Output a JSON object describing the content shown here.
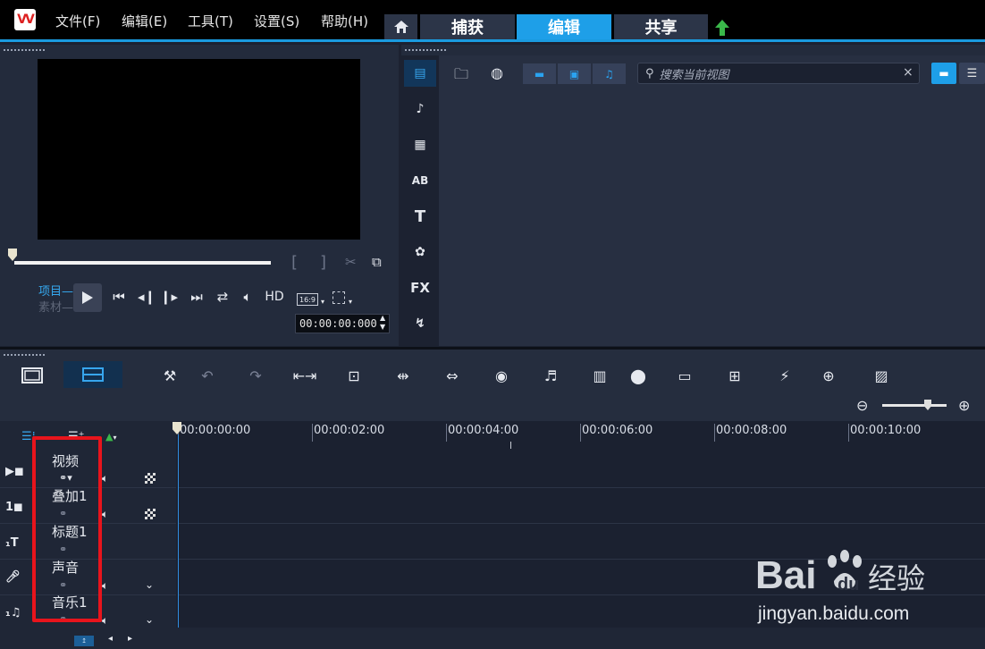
{
  "menu": {
    "items": [
      "文件(F)",
      "编辑(E)",
      "工具(T)",
      "设置(S)",
      "帮助(H)"
    ]
  },
  "tabs": [
    "捕获",
    "编辑",
    "共享"
  ],
  "active_tab": "编辑",
  "preview": {
    "mode_project": "项目",
    "mode_clip": "素材",
    "hd_label": "HD",
    "aspect_ratio": "16:9",
    "timecode": "00:00:00:000",
    "scrub_position": 0.0
  },
  "library": {
    "search_placeholder": "搜索当前视图",
    "sidebar": [
      "media-icon",
      "instant-project-icon",
      "transition-icon",
      "title-icon",
      "text-icon",
      "graphics-icon",
      "filter-icon",
      "path-icon"
    ],
    "sidebar_labels": {
      "title": "AB",
      "text": "T",
      "filter": "FX"
    }
  },
  "timeline": {
    "ruler_labels": [
      "00:00:00:00",
      "00:00:02:00",
      "00:00:04:00",
      "00:00:06:00",
      "00:00:08:00",
      "00:00:10:00"
    ],
    "zoom_level": 0.65,
    "tracks": [
      {
        "name": "视频",
        "icon": "video-track-icon"
      },
      {
        "name": "叠加1",
        "icon": "overlay-track-icon"
      },
      {
        "name": "标题1",
        "icon": "title-track-icon"
      },
      {
        "name": "声音",
        "icon": "voice-track-icon"
      },
      {
        "name": "音乐1",
        "icon": "music-track-icon"
      }
    ],
    "status_fit_label": "↥"
  },
  "watermark": {
    "brand": "Bai du 经验",
    "url": "jingyan.baidu.com"
  },
  "colors": {
    "accent": "#1e9fe8",
    "highlight_box": "#e8141c"
  }
}
